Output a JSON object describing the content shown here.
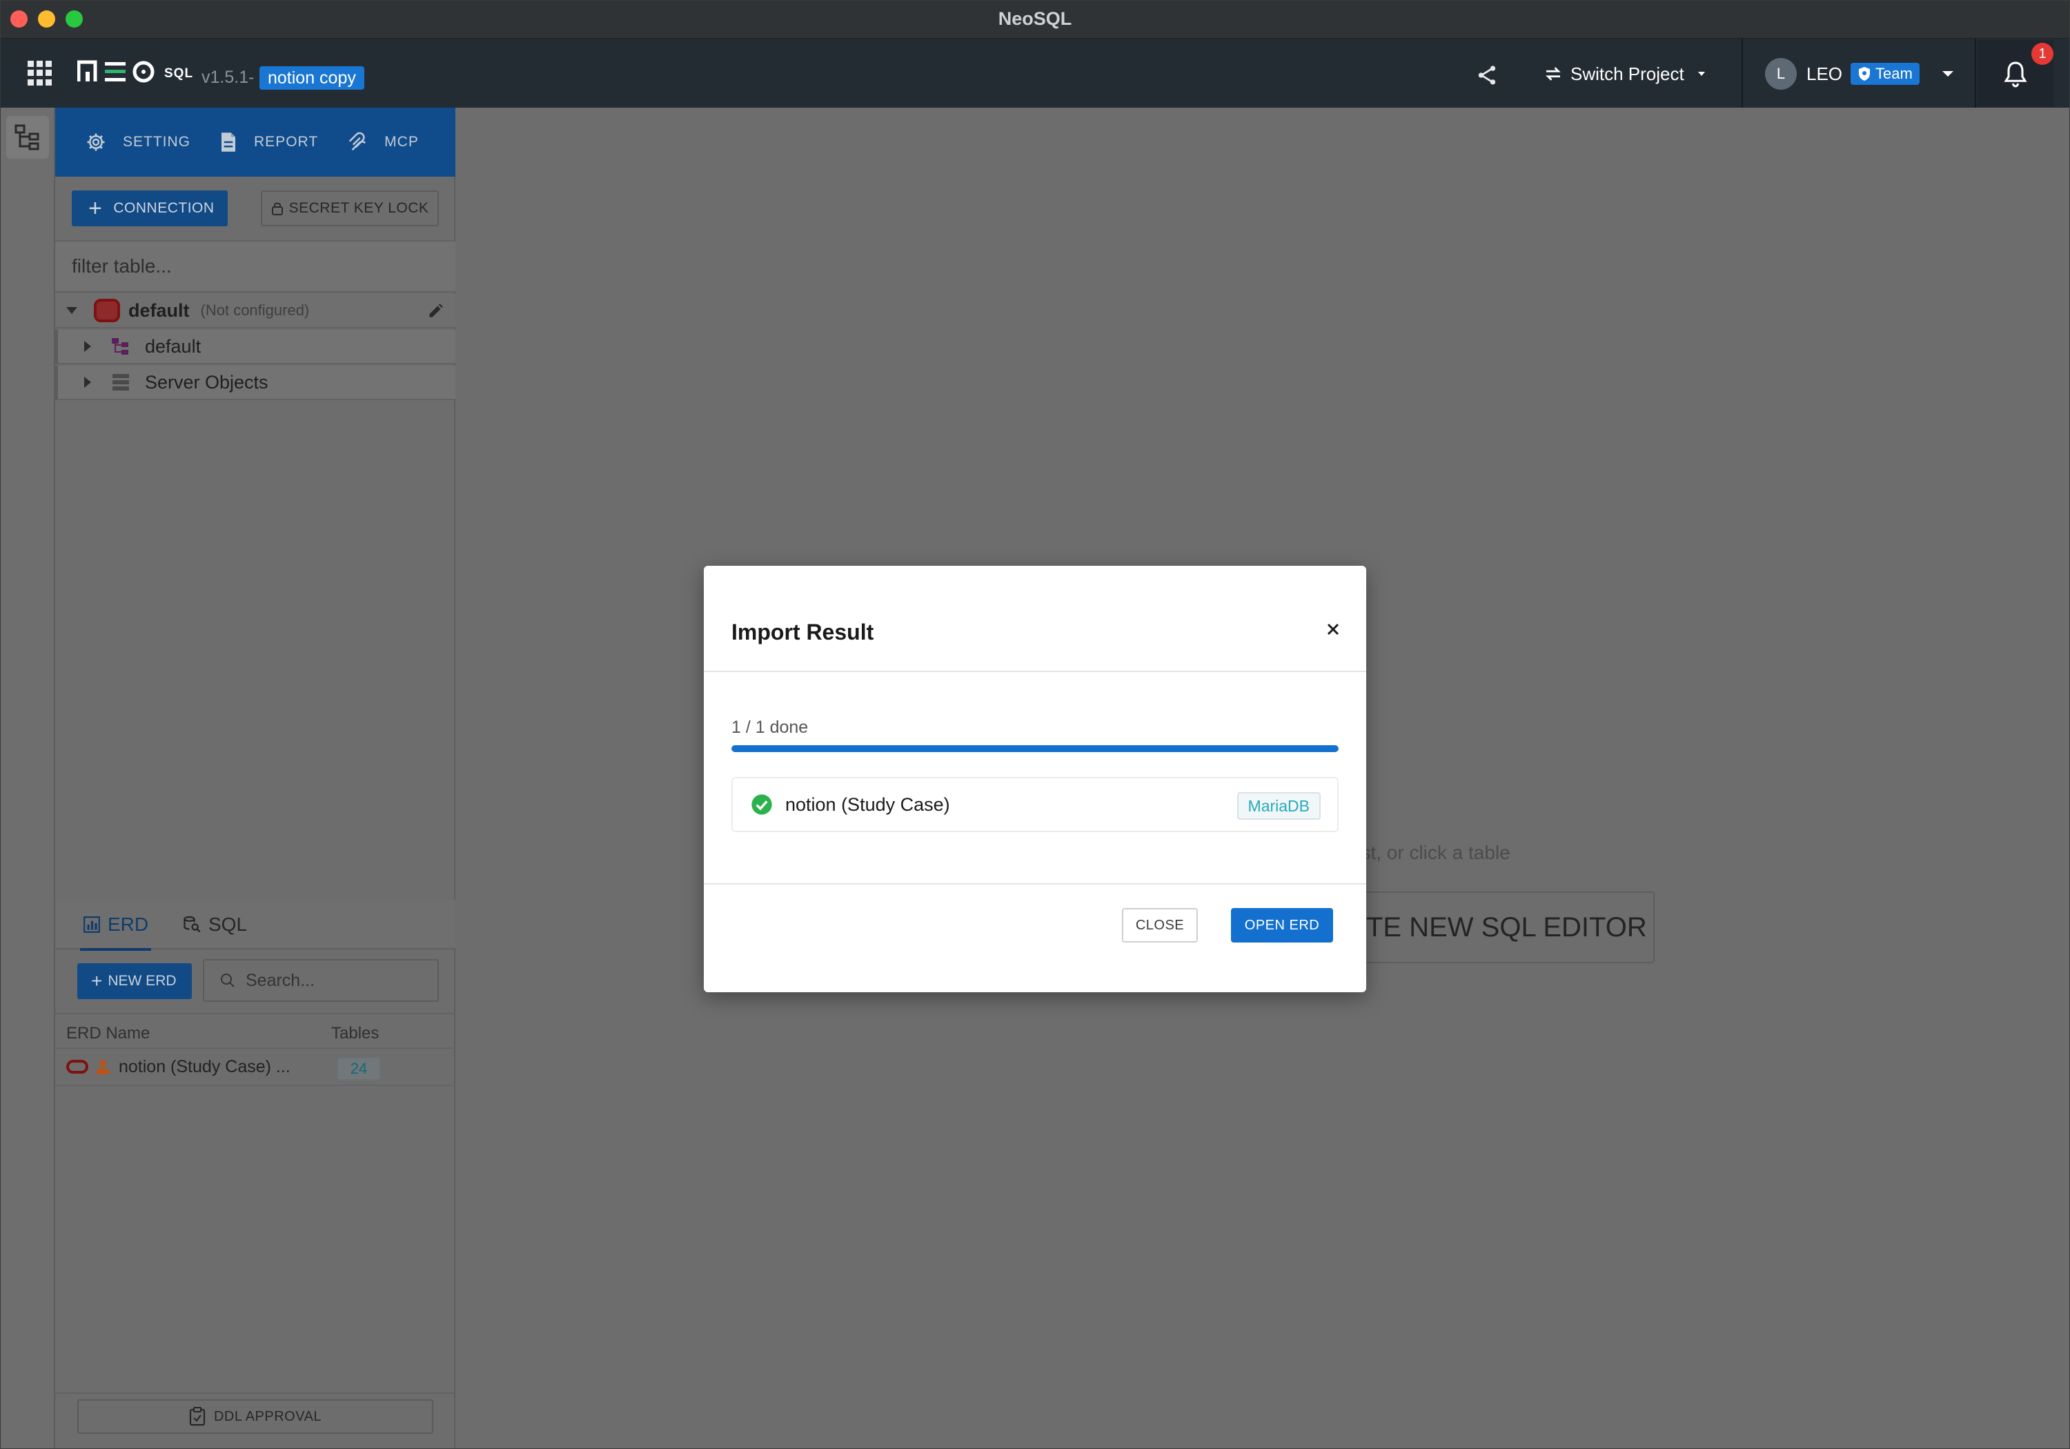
{
  "window": {
    "title": "NeoSQL"
  },
  "header": {
    "logo_text": "SQL",
    "version": "v1.5.1-",
    "project_badge": "notion copy",
    "switch_project_label": "Switch Project",
    "user_initial": "L",
    "user_name": "LEO",
    "team_badge": "Team",
    "notification_count": "1",
    "icons": [
      "apps-grid-icon",
      "share-icon",
      "switch-icon",
      "caret-down-icon",
      "shield-icon",
      "bell-icon"
    ]
  },
  "sidebar": {
    "nav": [
      {
        "label": "SETTING",
        "icon": "gear-icon"
      },
      {
        "label": "REPORT",
        "icon": "document-icon"
      },
      {
        "label": "MCP",
        "icon": "mcp-icon"
      }
    ],
    "connection_button": "CONNECTION",
    "secret_key_button": "SECRET KEY LOCK",
    "filter_placeholder": "filter table...",
    "tree": {
      "root_label": "default",
      "root_note": "(Not configured)",
      "children": [
        {
          "label": "default",
          "icon": "schema-icon"
        },
        {
          "label": "Server Objects",
          "icon": "server-icon"
        }
      ]
    },
    "erd_panel": {
      "tabs": [
        {
          "label": "ERD",
          "active": true
        },
        {
          "label": "SQL",
          "active": false
        }
      ],
      "new_erd_button": "NEW ERD",
      "search_placeholder": "Search...",
      "columns": [
        "ERD Name",
        "Tables"
      ],
      "rows": [
        {
          "name": "notion (Study Case) ...",
          "tables": "24"
        }
      ]
    },
    "ddl_approval_button": "DDL APPROVAL"
  },
  "main": {
    "hint_text": "list, or click a table",
    "create_button": "TE NEW SQL EDITOR"
  },
  "modal": {
    "title": "Import Result",
    "progress_label": "1 / 1 done",
    "progress_fraction": 1.0,
    "items": [
      {
        "name": "notion (Study Case)",
        "status": "success",
        "db_type": "MariaDB"
      }
    ],
    "close_button": "CLOSE",
    "open_button": "OPEN ERD"
  },
  "colors": {
    "accent": "#1470cf",
    "header_bg": "#232b33",
    "success": "#2bb24c",
    "db_tag_text": "#27aab8",
    "notification": "#e53935"
  }
}
